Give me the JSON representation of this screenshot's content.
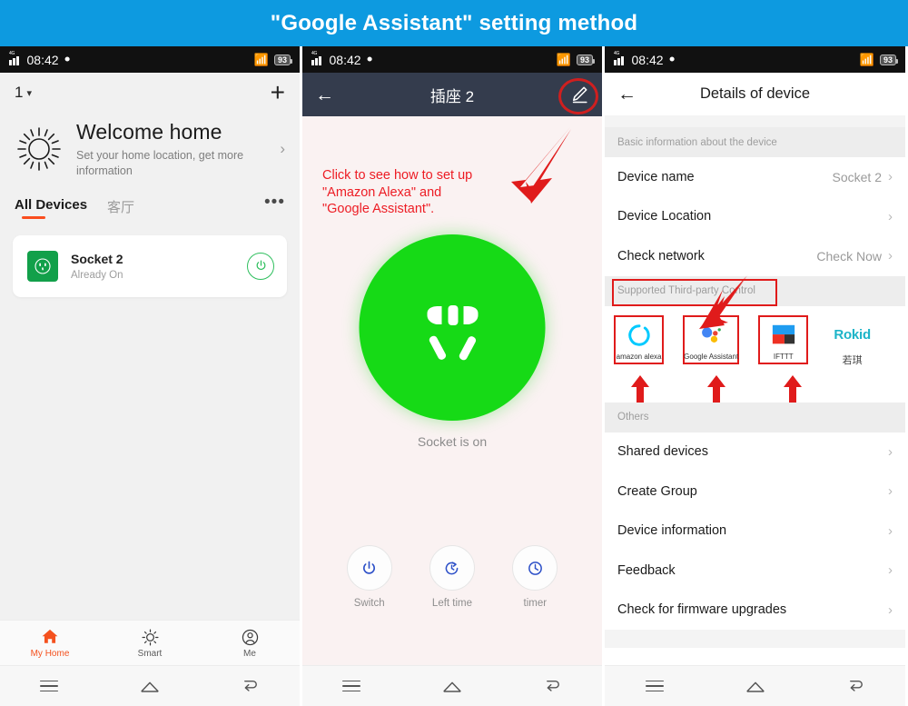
{
  "banner": {
    "title": "\"Google Assistant\" setting method",
    "bg": "#0d9ae0"
  },
  "status_bar": {
    "time": "08:42",
    "network": "4G",
    "battery": "93"
  },
  "android_nav": {
    "menu": "menu-icon",
    "home": "home-icon",
    "back": "back-icon"
  },
  "panel1": {
    "home_selector": "1",
    "add_label": "+",
    "welcome": {
      "title": "Welcome home",
      "subtitle": "Set your home location, get more information",
      "chevron": "›"
    },
    "tabs": [
      {
        "label": "All Devices",
        "active": true
      },
      {
        "label": "客厅",
        "active": false
      }
    ],
    "more_label": "•••",
    "device": {
      "name": "Socket 2",
      "state": "Already On",
      "icon_color": "#12a04a",
      "toggle_color": "#2fbf5e"
    },
    "tabbar": [
      {
        "label": "My Home",
        "icon": "home-filled-icon",
        "active": true
      },
      {
        "label": "Smart",
        "icon": "sun-icon",
        "active": false
      },
      {
        "label": "Me",
        "icon": "person-icon",
        "active": false
      }
    ],
    "accent": "#f4511e"
  },
  "panel2": {
    "appbar": {
      "title": "插座 2",
      "back": "←",
      "edit_icon": "pencil-icon",
      "bg": "#343c4d"
    },
    "annotation": "Click to see how to set up\n\"Amazon Alexa\" and\n\"Google Assistant\".",
    "annotation_color": "#ed1c24",
    "socket": {
      "state_text": "Socket is on",
      "color": "#16da16"
    },
    "actions": [
      {
        "label": "Switch",
        "icon": "power-icon"
      },
      {
        "label": "Left time",
        "icon": "countdown-icon"
      },
      {
        "label": "timer",
        "icon": "clock-icon"
      }
    ],
    "action_color": "#2d50c8"
  },
  "panel3": {
    "appbar": {
      "title": "Details of device",
      "back": "←"
    },
    "sections": [
      {
        "header": "Basic information about the device",
        "boxed": false,
        "rows": [
          {
            "label": "Device name",
            "value": "Socket 2",
            "chevron": "›"
          },
          {
            "label": "Device Location",
            "value": "",
            "chevron": "›"
          },
          {
            "label": "Check network",
            "value": "Check Now",
            "chevron": "›"
          }
        ]
      }
    ],
    "third_party": {
      "header": "Supported Third-party Control",
      "items": [
        {
          "label": "amazon alexa",
          "icon": "alexa-icon",
          "highlighted": true
        },
        {
          "label": "Google Assistant",
          "icon": "google-assistant-icon",
          "highlighted": true
        },
        {
          "label": "IFTTT",
          "icon": "ifttt-icon",
          "highlighted": true
        },
        {
          "label": "若琪",
          "icon": "rokid-icon",
          "highlighted": false,
          "wordmark": "Rokid"
        }
      ],
      "pager": {
        "total": 2,
        "current": 1
      }
    },
    "others": {
      "header": "Others",
      "rows": [
        {
          "label": "Shared devices",
          "chevron": "›"
        },
        {
          "label": "Create Group",
          "chevron": "›"
        },
        {
          "label": "Device information",
          "chevron": "›"
        },
        {
          "label": "Feedback",
          "chevron": "›"
        },
        {
          "label": "Check for firmware upgrades",
          "chevron": "›"
        }
      ]
    },
    "highlight_color": "#e01b1b"
  }
}
